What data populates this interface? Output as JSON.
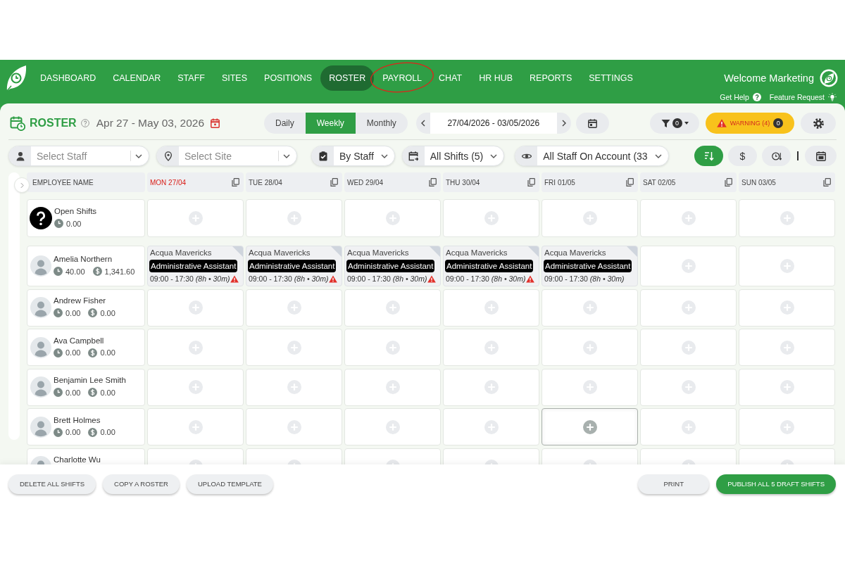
{
  "nav": {
    "items": [
      {
        "label": "DASHBOARD",
        "selected": false,
        "circled": false
      },
      {
        "label": "CALENDAR",
        "selected": false,
        "circled": false
      },
      {
        "label": "STAFF",
        "selected": false,
        "circled": false
      },
      {
        "label": "SITES",
        "selected": false,
        "circled": false
      },
      {
        "label": "POSITIONS",
        "selected": false,
        "circled": false
      },
      {
        "label": "ROSTER",
        "selected": true,
        "circled": false
      },
      {
        "label": "PAYROLL",
        "selected": false,
        "circled": true
      },
      {
        "label": "CHAT",
        "selected": false,
        "circled": false
      },
      {
        "label": "HR HUB",
        "selected": false,
        "circled": false
      },
      {
        "label": "REPORTS",
        "selected": false,
        "circled": false
      },
      {
        "label": "SETTINGS",
        "selected": false,
        "circled": false
      }
    ],
    "welcome": "Welcome Marketing",
    "links": [
      {
        "kind": "help",
        "label": "Get Help"
      },
      {
        "kind": "feature",
        "label": "Feature Request"
      }
    ]
  },
  "header": {
    "title": "ROSTER",
    "date_range": "Apr 27 - May 03, 2026",
    "views": [
      {
        "label": "Daily",
        "selected": false
      },
      {
        "label": "Weekly",
        "selected": true
      },
      {
        "label": "Monthly",
        "selected": false
      }
    ],
    "period": "27/04/2026 - 03/05/2026",
    "filter_count": "0",
    "warning": {
      "label": "WARNING (4)",
      "count": "0"
    }
  },
  "filters": [
    {
      "kind": "staff",
      "placeholder": "Select Staff"
    },
    {
      "kind": "site",
      "placeholder": "Select Site"
    },
    {
      "kind": "group",
      "value": "By Staff"
    },
    {
      "kind": "shifts",
      "value": "All Shifts (5)"
    },
    {
      "kind": "visibility",
      "value": "All Staff On Account (33"
    }
  ],
  "sort_buttons": [
    {
      "kind": "alpha",
      "selected": true
    },
    {
      "kind": "pay",
      "label": "$",
      "selected": false
    },
    {
      "kind": "time",
      "selected": false
    },
    {
      "kind": "calendar",
      "selected": false
    }
  ],
  "roster": {
    "name_heading": "EMPLOYEE NAME",
    "days": [
      {
        "label": "MON 27/04",
        "today": true
      },
      {
        "label": "TUE 28/04",
        "today": false
      },
      {
        "label": "WED 29/04",
        "today": false
      },
      {
        "label": "THU 30/04",
        "today": false
      },
      {
        "label": "FRI 01/05",
        "today": false
      },
      {
        "label": "SAT 02/05",
        "today": false
      },
      {
        "label": "SUN 03/05",
        "today": false
      }
    ],
    "rows": [
      {
        "kind": "open",
        "name": "Open Shifts",
        "hours": "0.00",
        "cells": [
          {
            "kind": "empty",
            "hovered": false
          },
          {
            "kind": "empty",
            "hovered": false
          },
          {
            "kind": "empty",
            "hovered": false
          },
          {
            "kind": "empty",
            "hovered": false
          },
          {
            "kind": "empty",
            "hovered": false
          },
          {
            "kind": "empty",
            "hovered": false
          },
          {
            "kind": "empty",
            "hovered": false
          }
        ]
      },
      {
        "kind": "staff",
        "name": "Amelia Northern",
        "hours": "40.00",
        "pay": "1,341.60",
        "cells": [
          {
            "kind": "shift",
            "site": "Acqua Mavericks",
            "position": "Administrative Assistant",
            "time": "09:00 - 17:30 *(8h • 30m)*",
            "warning": true,
            "hovered": false
          },
          {
            "kind": "shift",
            "site": "Acqua Mavericks",
            "position": "Administrative Assistant",
            "time": "09:00 - 17:30 *(8h • 30m)*",
            "warning": true,
            "hovered": false
          },
          {
            "kind": "shift",
            "site": "Acqua Mavericks",
            "position": "Administrative Assistant",
            "time": "09:00 - 17:30 *(8h • 30m)*",
            "warning": true,
            "hovered": false
          },
          {
            "kind": "shift",
            "site": "Acqua Mavericks",
            "position": "Administrative Assistant",
            "time": "09:00 - 17:30 *(8h • 30m)*",
            "warning": true,
            "hovered": false
          },
          {
            "kind": "shift",
            "site": "Acqua Mavericks",
            "position": "Administrative Assistant",
            "time": "09:00 - 17:30 *(8h • 30m)*",
            "warning": false,
            "hovered": false
          },
          {
            "kind": "empty",
            "hovered": false
          },
          {
            "kind": "empty",
            "hovered": false
          }
        ]
      },
      {
        "kind": "staff",
        "name": "Andrew Fisher",
        "hours": "0.00",
        "pay": "0.00",
        "cells": [
          {
            "kind": "empty",
            "hovered": false
          },
          {
            "kind": "empty",
            "hovered": false
          },
          {
            "kind": "empty",
            "hovered": false
          },
          {
            "kind": "empty",
            "hovered": false
          },
          {
            "kind": "empty",
            "hovered": false
          },
          {
            "kind": "empty",
            "hovered": false
          },
          {
            "kind": "empty",
            "hovered": false
          }
        ]
      },
      {
        "kind": "staff",
        "name": "Ava Campbell",
        "hours": "0.00",
        "pay": "0.00",
        "cells": [
          {
            "kind": "empty",
            "hovered": false
          },
          {
            "kind": "empty",
            "hovered": false
          },
          {
            "kind": "empty",
            "hovered": false
          },
          {
            "kind": "empty",
            "hovered": false
          },
          {
            "kind": "empty",
            "hovered": false
          },
          {
            "kind": "empty",
            "hovered": false
          },
          {
            "kind": "empty",
            "hovered": false
          }
        ]
      },
      {
        "kind": "staff",
        "name": "Benjamin Lee Smith",
        "hours": "0.00",
        "pay": "0.00",
        "cells": [
          {
            "kind": "empty",
            "hovered": false
          },
          {
            "kind": "empty",
            "hovered": false
          },
          {
            "kind": "empty",
            "hovered": false
          },
          {
            "kind": "empty",
            "hovered": false
          },
          {
            "kind": "empty",
            "hovered": false
          },
          {
            "kind": "empty",
            "hovered": false
          },
          {
            "kind": "empty",
            "hovered": false
          }
        ]
      },
      {
        "kind": "staff",
        "name": "Brett Holmes",
        "hours": "0.00",
        "pay": "0.00",
        "cells": [
          {
            "kind": "empty",
            "hovered": false
          },
          {
            "kind": "empty",
            "hovered": false
          },
          {
            "kind": "empty",
            "hovered": false
          },
          {
            "kind": "empty",
            "hovered": false
          },
          {
            "kind": "empty",
            "hovered": true
          },
          {
            "kind": "empty",
            "hovered": false
          },
          {
            "kind": "empty",
            "hovered": false
          }
        ]
      },
      {
        "kind": "staff",
        "name": "Charlotte Wu",
        "cells": [
          {
            "kind": "empty",
            "hovered": false
          },
          {
            "kind": "empty",
            "hovered": false
          },
          {
            "kind": "empty",
            "hovered": false
          },
          {
            "kind": "empty",
            "hovered": false
          },
          {
            "kind": "empty",
            "hovered": false
          },
          {
            "kind": "empty",
            "hovered": false
          },
          {
            "kind": "empty",
            "hovered": false
          }
        ]
      }
    ]
  },
  "footer": {
    "left_actions": [
      {
        "label": "DELETE ALL SHIFTS",
        "kind": "plain"
      },
      {
        "label": "COPY A ROSTER",
        "kind": "plain"
      },
      {
        "label": "UPLOAD TEMPLATE",
        "kind": "plain"
      }
    ],
    "right_actions": [
      {
        "label": "PRINT",
        "kind": "plain"
      },
      {
        "label": "PUBLISH ALL 5 DRAFT SHIFTS",
        "kind": "primary"
      }
    ]
  }
}
